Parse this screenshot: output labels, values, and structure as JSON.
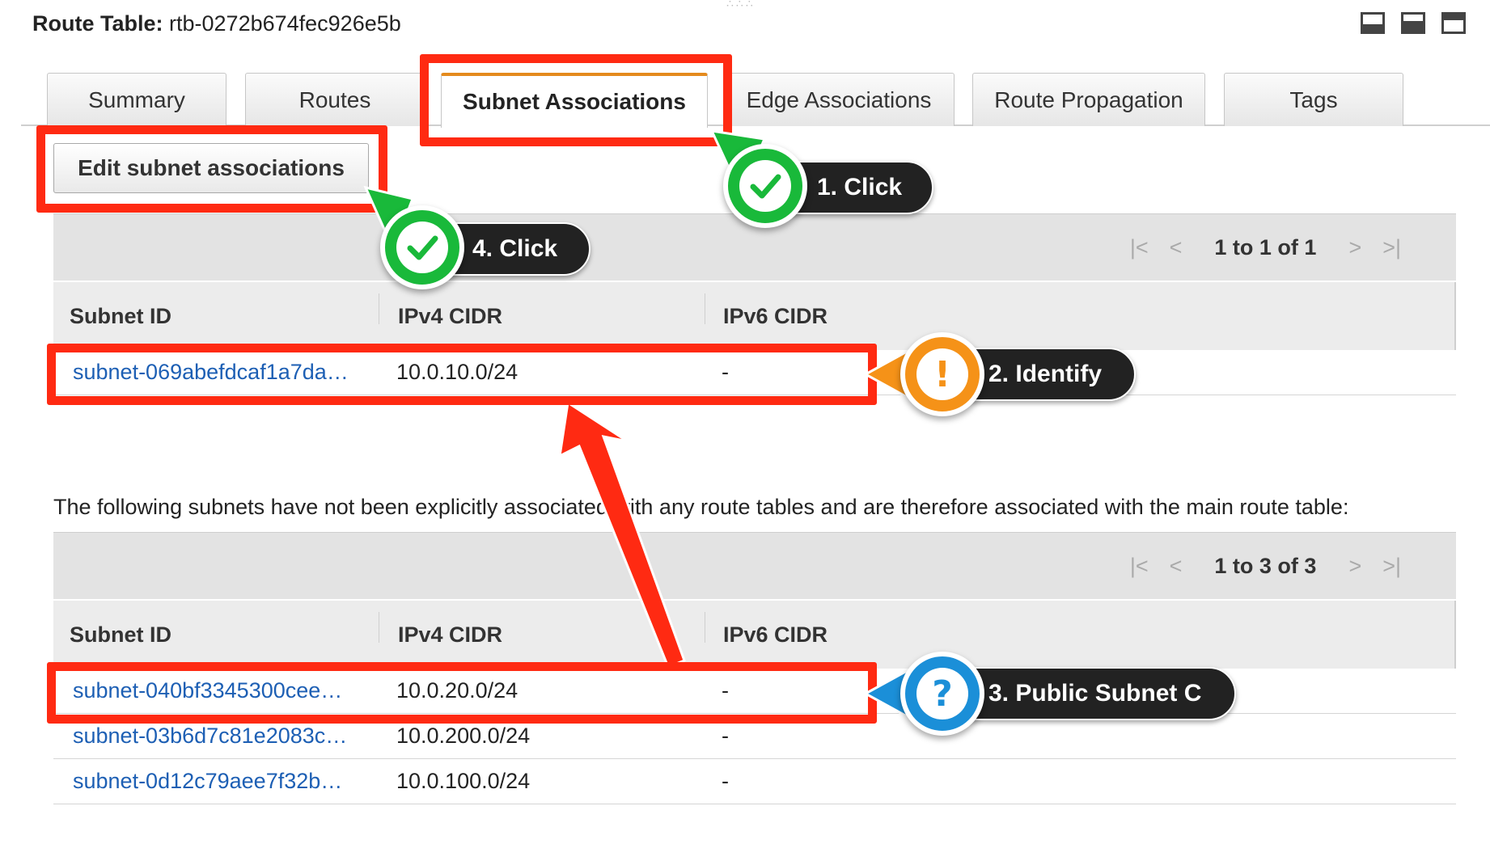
{
  "header": {
    "label": "Route Table:",
    "route_table_id": "rtb-0272b674fec926e5b",
    "drag_handle": "∴∴∴"
  },
  "tabs": [
    {
      "label": "Summary",
      "active": false
    },
    {
      "label": "Routes",
      "active": false
    },
    {
      "label": "Subnet Associations",
      "active": true
    },
    {
      "label": "Edge Associations",
      "active": false
    },
    {
      "label": "Route Propagation",
      "active": false
    },
    {
      "label": "Tags",
      "active": false
    }
  ],
  "edit_button": "Edit subnet associations",
  "associated_grid": {
    "pager_text": "1 to 1 of 1",
    "columns": [
      "Subnet ID",
      "IPv4 CIDR",
      "IPv6 CIDR"
    ],
    "rows": [
      {
        "subnet_id": "subnet-069abefdcaf1a7da…",
        "ipv4": "10.0.10.0/24",
        "ipv6": "-"
      }
    ]
  },
  "info_text": "The following subnets have not been explicitly associated with any route tables and are therefore associated with the main route table:",
  "main_grid": {
    "pager_text": "1 to 3 of 3",
    "columns": [
      "Subnet ID",
      "IPv4 CIDR",
      "IPv6 CIDR"
    ],
    "rows": [
      {
        "subnet_id": "subnet-040bf3345300cee…",
        "ipv4": "10.0.20.0/24",
        "ipv6": "-"
      },
      {
        "subnet_id": "subnet-03b6d7c81e2083c…",
        "ipv4": "10.0.200.0/24",
        "ipv6": "-"
      },
      {
        "subnet_id": "subnet-0d12c79aee7f32b…",
        "ipv4": "10.0.100.0/24",
        "ipv6": "-"
      }
    ]
  },
  "annotations": {
    "step1": "1. Click",
    "step2": "2. Identify",
    "step3": "3. Public Subnet C",
    "step4": "4. Click",
    "badge_exclaim": "!",
    "badge_question": "?"
  },
  "colors": {
    "highlight": "#ff2a12",
    "active_tab_accent": "#e48a1d",
    "link": "#1d5fb4",
    "badge_green": "#19b93a",
    "badge_orange": "#f59218",
    "badge_blue": "#1b8fd8"
  },
  "icons": [
    "first-page-icon",
    "prev-page-icon",
    "next-page-icon",
    "last-page-icon",
    "checkmark-icon",
    "panel-layout-icon"
  ]
}
